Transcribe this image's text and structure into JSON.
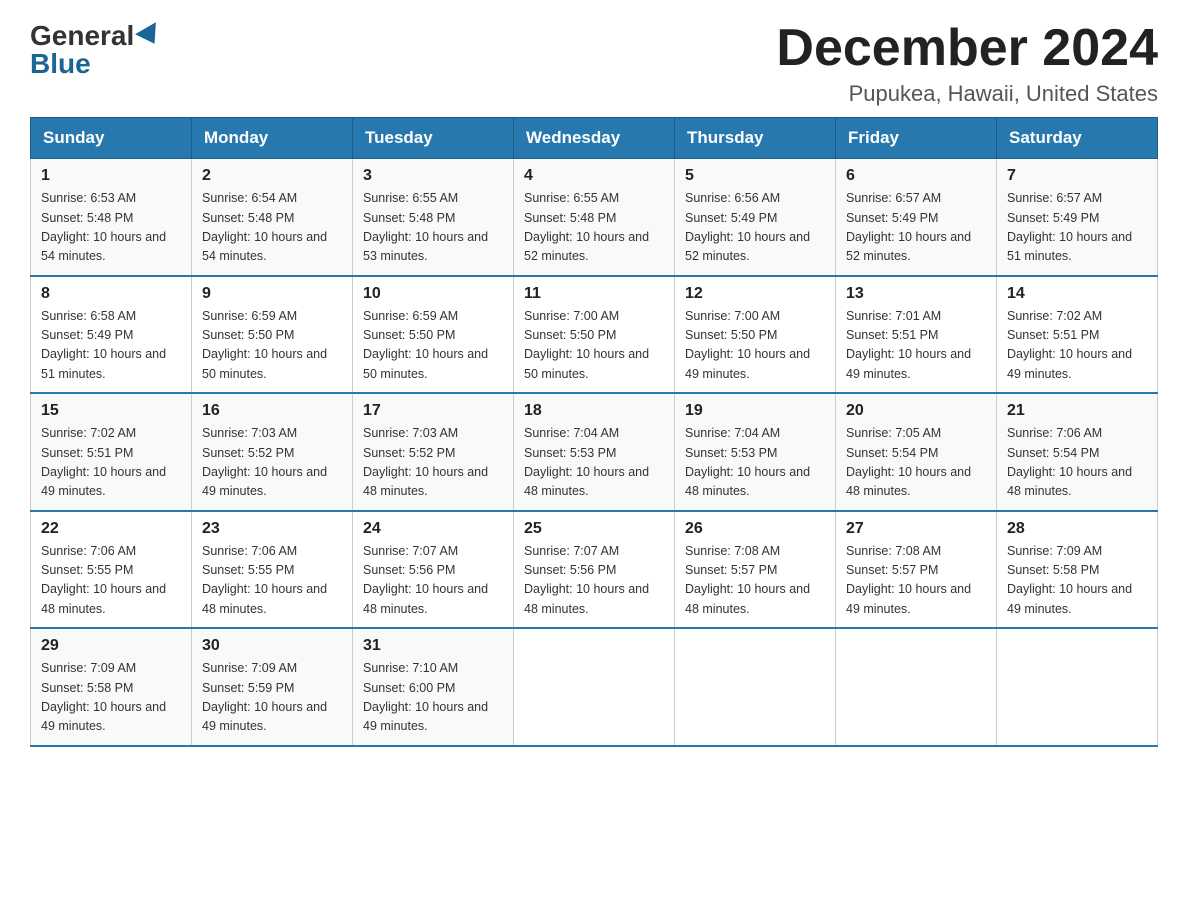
{
  "header": {
    "logo_text_general": "General",
    "logo_text_blue": "Blue",
    "month_title": "December 2024",
    "location": "Pupukea, Hawaii, United States"
  },
  "days_of_week": [
    "Sunday",
    "Monday",
    "Tuesday",
    "Wednesday",
    "Thursday",
    "Friday",
    "Saturday"
  ],
  "weeks": [
    [
      {
        "day": "1",
        "sunrise": "6:53 AM",
        "sunset": "5:48 PM",
        "daylight": "10 hours and 54 minutes."
      },
      {
        "day": "2",
        "sunrise": "6:54 AM",
        "sunset": "5:48 PM",
        "daylight": "10 hours and 54 minutes."
      },
      {
        "day": "3",
        "sunrise": "6:55 AM",
        "sunset": "5:48 PM",
        "daylight": "10 hours and 53 minutes."
      },
      {
        "day": "4",
        "sunrise": "6:55 AM",
        "sunset": "5:48 PM",
        "daylight": "10 hours and 52 minutes."
      },
      {
        "day": "5",
        "sunrise": "6:56 AM",
        "sunset": "5:49 PM",
        "daylight": "10 hours and 52 minutes."
      },
      {
        "day": "6",
        "sunrise": "6:57 AM",
        "sunset": "5:49 PM",
        "daylight": "10 hours and 52 minutes."
      },
      {
        "day": "7",
        "sunrise": "6:57 AM",
        "sunset": "5:49 PM",
        "daylight": "10 hours and 51 minutes."
      }
    ],
    [
      {
        "day": "8",
        "sunrise": "6:58 AM",
        "sunset": "5:49 PM",
        "daylight": "10 hours and 51 minutes."
      },
      {
        "day": "9",
        "sunrise": "6:59 AM",
        "sunset": "5:50 PM",
        "daylight": "10 hours and 50 minutes."
      },
      {
        "day": "10",
        "sunrise": "6:59 AM",
        "sunset": "5:50 PM",
        "daylight": "10 hours and 50 minutes."
      },
      {
        "day": "11",
        "sunrise": "7:00 AM",
        "sunset": "5:50 PM",
        "daylight": "10 hours and 50 minutes."
      },
      {
        "day": "12",
        "sunrise": "7:00 AM",
        "sunset": "5:50 PM",
        "daylight": "10 hours and 49 minutes."
      },
      {
        "day": "13",
        "sunrise": "7:01 AM",
        "sunset": "5:51 PM",
        "daylight": "10 hours and 49 minutes."
      },
      {
        "day": "14",
        "sunrise": "7:02 AM",
        "sunset": "5:51 PM",
        "daylight": "10 hours and 49 minutes."
      }
    ],
    [
      {
        "day": "15",
        "sunrise": "7:02 AM",
        "sunset": "5:51 PM",
        "daylight": "10 hours and 49 minutes."
      },
      {
        "day": "16",
        "sunrise": "7:03 AM",
        "sunset": "5:52 PM",
        "daylight": "10 hours and 49 minutes."
      },
      {
        "day": "17",
        "sunrise": "7:03 AM",
        "sunset": "5:52 PM",
        "daylight": "10 hours and 48 minutes."
      },
      {
        "day": "18",
        "sunrise": "7:04 AM",
        "sunset": "5:53 PM",
        "daylight": "10 hours and 48 minutes."
      },
      {
        "day": "19",
        "sunrise": "7:04 AM",
        "sunset": "5:53 PM",
        "daylight": "10 hours and 48 minutes."
      },
      {
        "day": "20",
        "sunrise": "7:05 AM",
        "sunset": "5:54 PM",
        "daylight": "10 hours and 48 minutes."
      },
      {
        "day": "21",
        "sunrise": "7:06 AM",
        "sunset": "5:54 PM",
        "daylight": "10 hours and 48 minutes."
      }
    ],
    [
      {
        "day": "22",
        "sunrise": "7:06 AM",
        "sunset": "5:55 PM",
        "daylight": "10 hours and 48 minutes."
      },
      {
        "day": "23",
        "sunrise": "7:06 AM",
        "sunset": "5:55 PM",
        "daylight": "10 hours and 48 minutes."
      },
      {
        "day": "24",
        "sunrise": "7:07 AM",
        "sunset": "5:56 PM",
        "daylight": "10 hours and 48 minutes."
      },
      {
        "day": "25",
        "sunrise": "7:07 AM",
        "sunset": "5:56 PM",
        "daylight": "10 hours and 48 minutes."
      },
      {
        "day": "26",
        "sunrise": "7:08 AM",
        "sunset": "5:57 PM",
        "daylight": "10 hours and 48 minutes."
      },
      {
        "day": "27",
        "sunrise": "7:08 AM",
        "sunset": "5:57 PM",
        "daylight": "10 hours and 49 minutes."
      },
      {
        "day": "28",
        "sunrise": "7:09 AM",
        "sunset": "5:58 PM",
        "daylight": "10 hours and 49 minutes."
      }
    ],
    [
      {
        "day": "29",
        "sunrise": "7:09 AM",
        "sunset": "5:58 PM",
        "daylight": "10 hours and 49 minutes."
      },
      {
        "day": "30",
        "sunrise": "7:09 AM",
        "sunset": "5:59 PM",
        "daylight": "10 hours and 49 minutes."
      },
      {
        "day": "31",
        "sunrise": "7:10 AM",
        "sunset": "6:00 PM",
        "daylight": "10 hours and 49 minutes."
      },
      null,
      null,
      null,
      null
    ]
  ]
}
